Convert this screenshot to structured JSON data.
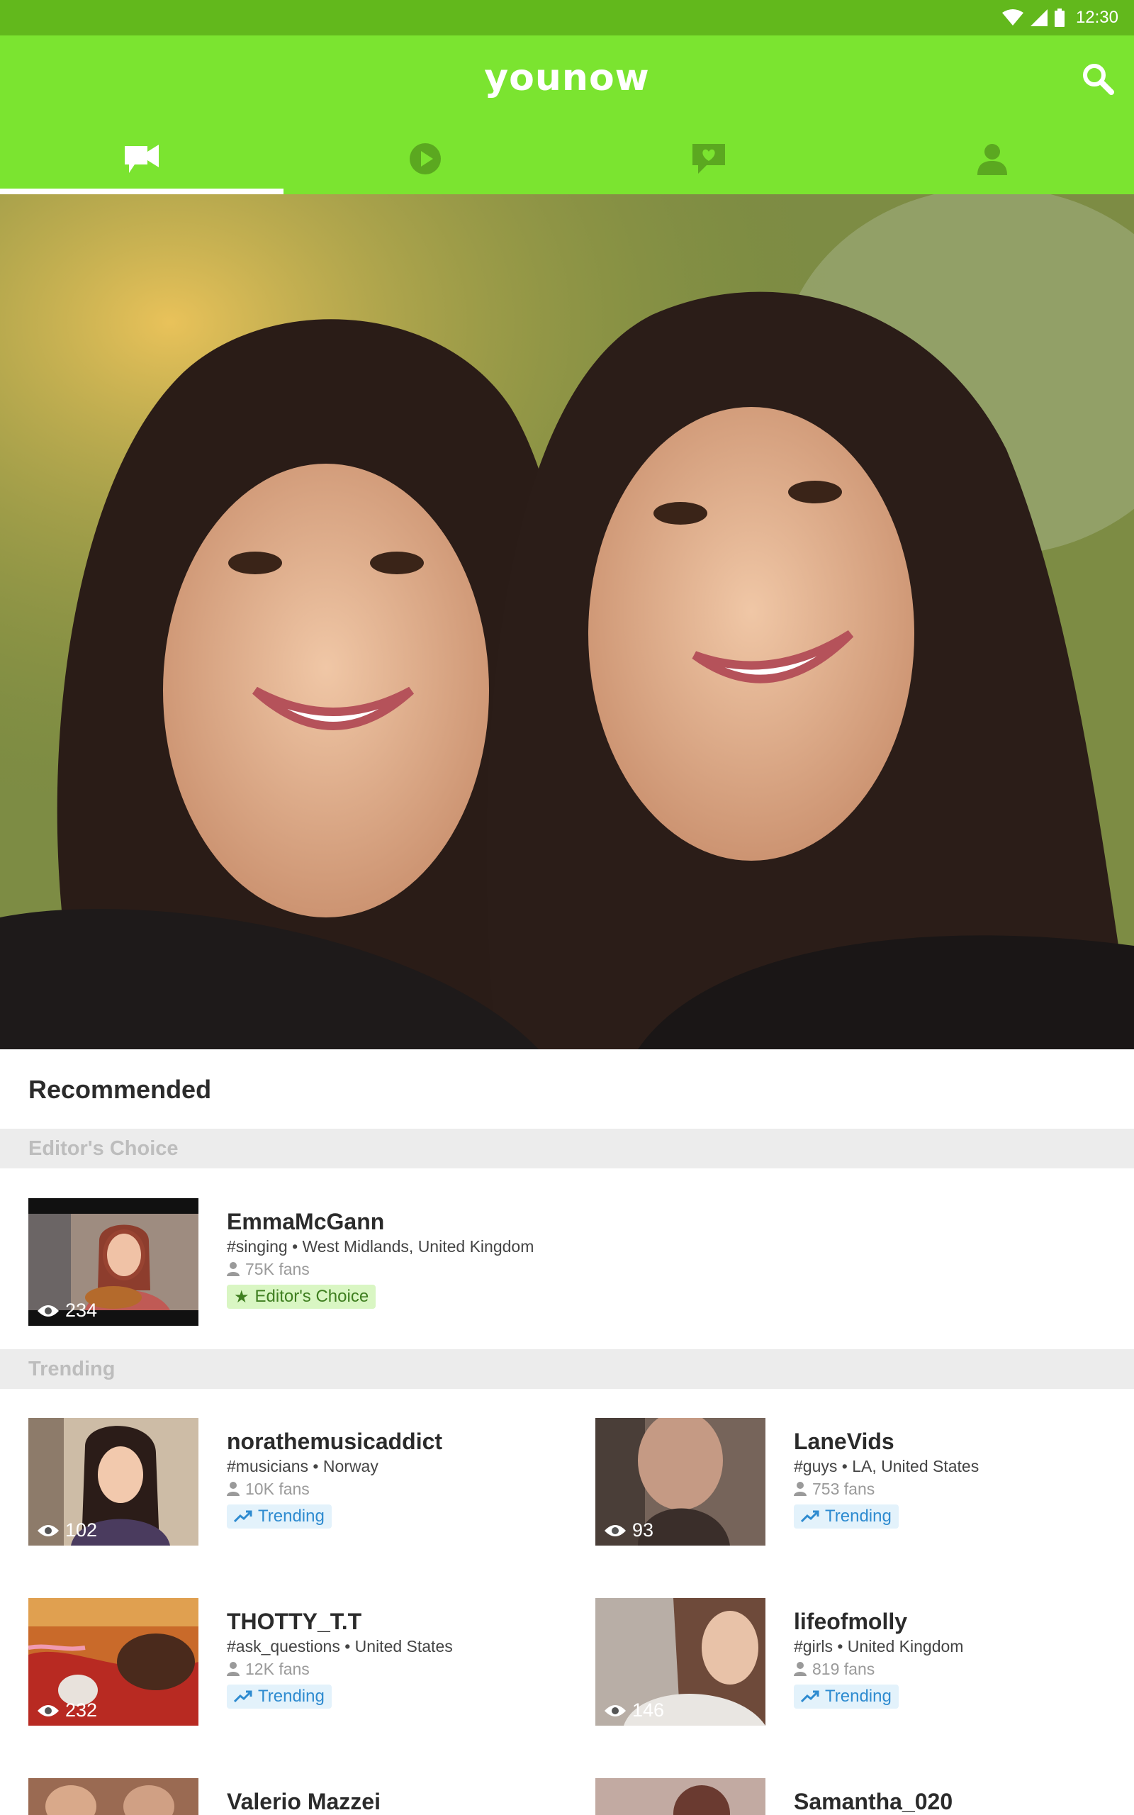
{
  "status": {
    "time": "12:30"
  },
  "app": {
    "logo_text": "younow"
  },
  "tabs": [
    {
      "icon": "video-camera-icon"
    },
    {
      "icon": "play-icon"
    },
    {
      "icon": "chat-heart-icon"
    },
    {
      "icon": "profile-icon"
    }
  ],
  "section": {
    "title": "Recommended"
  },
  "editors_choice": {
    "label": "Editor's Choice",
    "card": {
      "views": "234",
      "name": "EmmaMcGann",
      "meta": "#singing • West Midlands, United Kingdom",
      "fans": "75K fans",
      "badge": "Editor's Choice"
    }
  },
  "trending": {
    "label": "Trending",
    "cards": [
      {
        "views": "102",
        "name": "norathemusicaddict",
        "meta": "#musicians • Norway",
        "fans": "10K fans",
        "badge": "Trending"
      },
      {
        "views": "93",
        "name": "LaneVids",
        "meta": "#guys • LA, United States",
        "fans": "753 fans",
        "badge": "Trending"
      },
      {
        "views": "232",
        "name": "THOTTY_T.T",
        "meta": "#ask_questions • United States",
        "fans": "12K fans",
        "badge": "Trending"
      },
      {
        "views": "146",
        "name": "lifeofmolly",
        "meta": "#girls • United Kingdom",
        "fans": "819 fans",
        "badge": "Trending"
      },
      {
        "name": "Valerio Mazzei"
      },
      {
        "name": "Samantha_020"
      }
    ]
  },
  "colors": {
    "status_bar": "#62b81c",
    "app_bar": "#7be430",
    "trend_badge": "#2e8bd0",
    "editor_badge": "#3f7f20"
  }
}
